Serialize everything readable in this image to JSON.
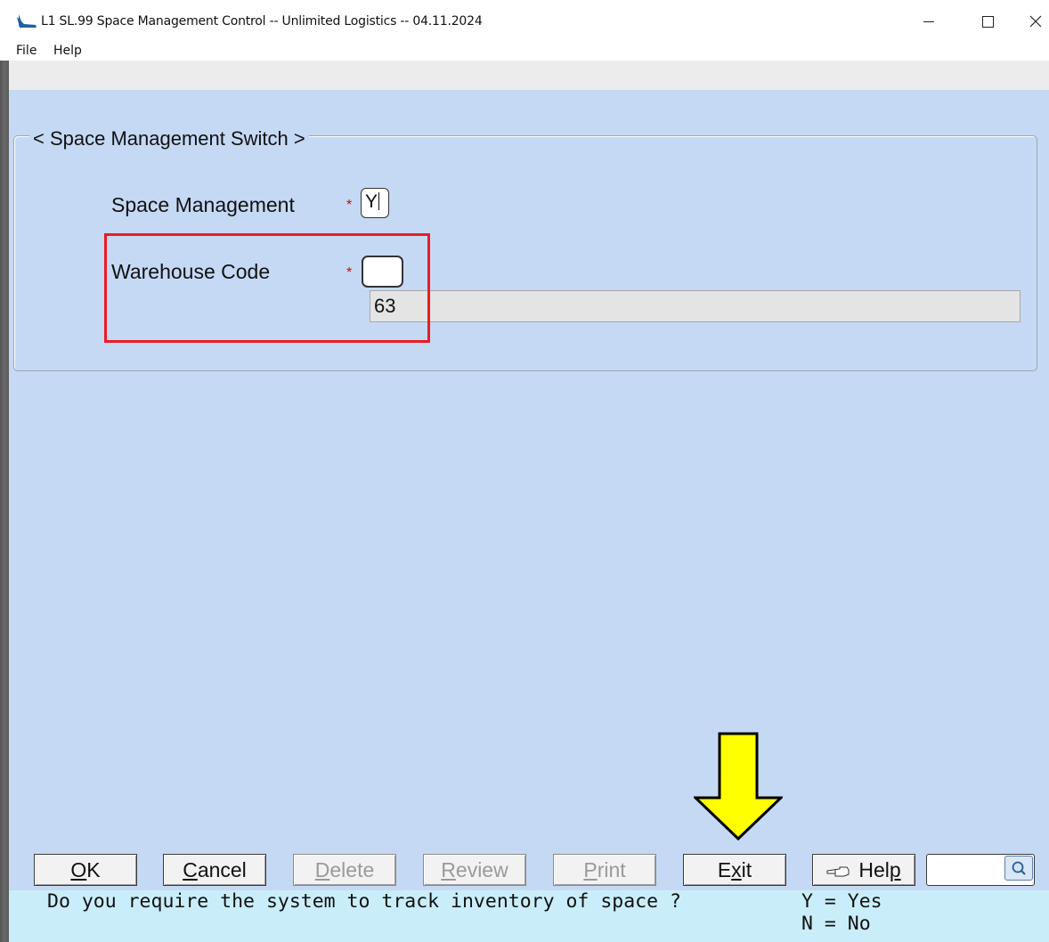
{
  "window": {
    "title": "L1 SL.99 Space Management Control -- Unlimited Logistics -- 04.11.2024",
    "minimize": "–",
    "maximize": "□",
    "close": "×"
  },
  "menu": {
    "items": [
      {
        "label": "File"
      },
      {
        "label": "Help"
      }
    ]
  },
  "form": {
    "group_title": "< Space Management Switch >",
    "fields": [
      {
        "label": "Space Management",
        "required_mark": "*",
        "value": "Y"
      },
      {
        "label": "Warehouse Code",
        "required_mark": "*",
        "value": "",
        "description": "63"
      }
    ]
  },
  "buttons": {
    "ok": {
      "accel": "O",
      "rest": "K",
      "enabled": true
    },
    "cancel": {
      "accel": "C",
      "rest": "ancel",
      "enabled": true
    },
    "delete": {
      "accel": "D",
      "rest": "elete",
      "enabled": false
    },
    "review": {
      "accel": "R",
      "rest": "eview",
      "enabled": false
    },
    "print": {
      "accel": "P",
      "rest": "rint",
      "enabled": false
    },
    "exit": {
      "pre": "E",
      "accel": "x",
      "rest": "it",
      "enabled": true
    },
    "help": {
      "pre": "Hel",
      "accel": "p",
      "enabled": true,
      "icon": "pointing-hand-icon"
    },
    "search": {
      "icon": "magnifier-icon",
      "value": ""
    }
  },
  "status": {
    "message": "Do you require the system to track inventory of space ?",
    "options": [
      "Y = Yes",
      "N = No"
    ]
  },
  "annotations": {
    "highlight_color": "#ea1c24",
    "arrow_color": "#ffff00"
  }
}
